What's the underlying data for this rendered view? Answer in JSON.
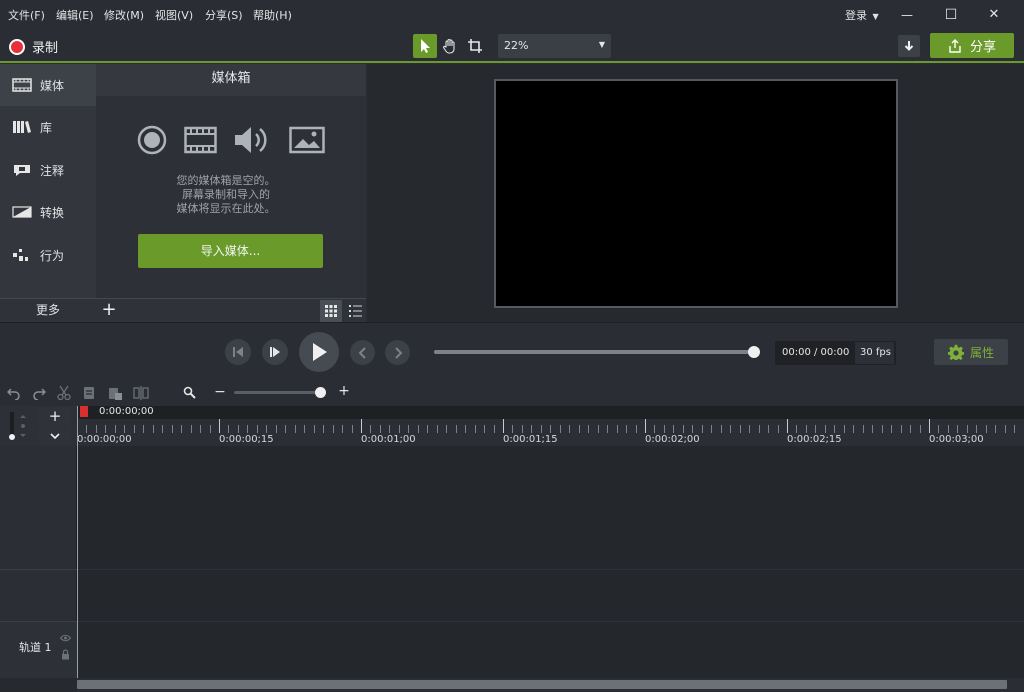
{
  "menu": [
    "文件(F)",
    "编辑(E)",
    "修改(M)",
    "视图(V)",
    "分享(S)",
    "帮助(H)"
  ],
  "account": {
    "login_label": "登录"
  },
  "window": {
    "minimize": "—",
    "maximize": "☐",
    "close": "✕"
  },
  "toolbar": {
    "record_label": "录制",
    "zoom_value": "22%",
    "share_label": "分享"
  },
  "nav": {
    "items": [
      {
        "label": "媒体",
        "icon": "film-icon"
      },
      {
        "label": "库",
        "icon": "books-icon"
      },
      {
        "label": "注释",
        "icon": "annotation-icon"
      },
      {
        "label": "转换",
        "icon": "transition-icon"
      },
      {
        "label": "行为",
        "icon": "behavior-icon"
      }
    ],
    "more_label": "更多"
  },
  "media_bin": {
    "title": "媒体箱",
    "empty_line1": "您的媒体箱是空的。",
    "empty_line2": "屏幕录制和导入的",
    "empty_line3": "媒体将显示在此处。",
    "import_label": "导入媒体...",
    "icons": [
      "record-icon",
      "film-strip-icon",
      "audio-icon",
      "image-icon"
    ]
  },
  "playback": {
    "time": "00:00 / 00:00",
    "fps": "30 fps",
    "properties_label": "属性",
    "progress": 1.0
  },
  "timeline": {
    "playhead_time": "0:00:00;00",
    "ticks": [
      "0:00:00;00",
      "0:00:00;15",
      "0:00:01;00",
      "0:00:01;15",
      "0:00:02;00",
      "0:00:02;15",
      "0:00:03;00"
    ],
    "track_label": "轨道 1"
  },
  "colors": {
    "accent": "#6a9a2a",
    "record": "#e8303a",
    "background": "#2b2e34"
  }
}
